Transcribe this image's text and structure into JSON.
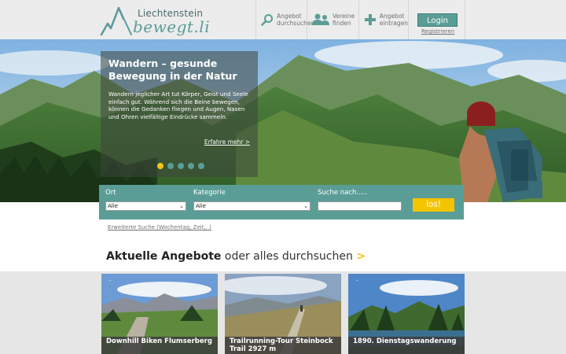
{
  "header": {
    "logo_top": "Liechtenstein",
    "logo_bottom": "bewegt.li",
    "nav": [
      {
        "label_line1": "Angebot",
        "label_line2": "durchsuchen",
        "icon": "search-icon"
      },
      {
        "label_line1": "Vereine",
        "label_line2": "finden",
        "icon": "people-icon"
      },
      {
        "label_line1": "Angebot",
        "label_line2": "eintragen",
        "icon": "plus-icon"
      }
    ],
    "login_label": "Login",
    "register_label": "Registrieren"
  },
  "hero": {
    "title": "Wandern – gesunde Bewegung in der Natur",
    "text": "Wandern jeglicher Art tut Körper, Geist und Seele einfach gut. Während sich die Beine bewegen, können die Gedanken fliegen und Augen, Nasen und Ohren vielfältige Eindrücke sammeln.",
    "more_link": "Erfahre mehr >",
    "slides": 5,
    "active_slide": 1
  },
  "search": {
    "ort_label": "Ort",
    "ort_value": "Alle",
    "kategorie_label": "Kategorie",
    "kategorie_value": "Alle",
    "suche_label": "Suche nach.....",
    "suche_value": "",
    "go_label": "los!",
    "extended_link": "Erweiterte Suche (Wochentag, Zeit,..)"
  },
  "section": {
    "heading_strong": "Aktuelle Angebote",
    "heading_light": "oder alles durchsuchen",
    "heading_arrow": ">"
  },
  "cards": [
    {
      "tag": "-",
      "title": "Downhill Biken Flumserberg"
    },
    {
      "tag": "-",
      "title": "Trailrunning-Tour Steinbock Trail 2927 m"
    },
    {
      "tag": "-",
      "title": "1890. Dienstagswanderung"
    }
  ],
  "colors": {
    "accent": "#5a9d96",
    "highlight": "#f5c400",
    "header_bg": "#ececec"
  }
}
